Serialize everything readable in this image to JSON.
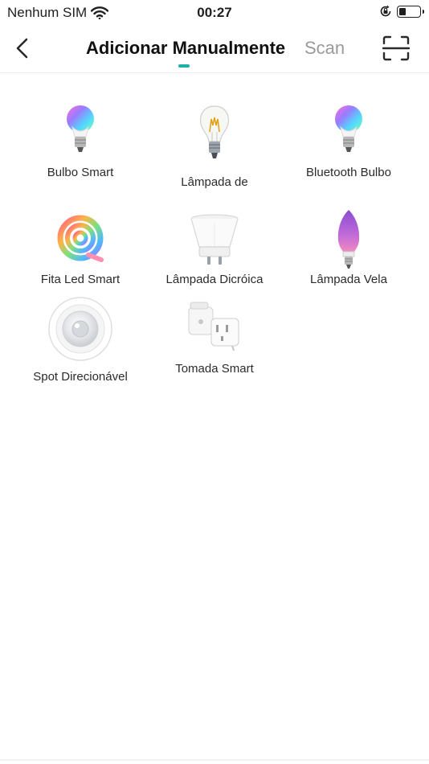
{
  "status_bar": {
    "carrier": "Nenhum SIM",
    "time": "00:27",
    "battery_level": 0.35
  },
  "header": {
    "tab_manual": "Adicionar Manualmente",
    "tab_scan": "Scan",
    "icons": [
      "chevron-left-icon",
      "scan-frame-icon"
    ],
    "accent": "#1fb2a6"
  },
  "devices": [
    {
      "label": "Bulbo Smart",
      "icon": "rgb-bulb-icon"
    },
    {
      "label": "Lâmpada de",
      "icon": "filament-bulb-icon"
    },
    {
      "label": "Bluetooth Bulbo",
      "icon": "rgb-bulb-icon"
    },
    {
      "label": "Fita Led Smart",
      "icon": "led-strip-icon"
    },
    {
      "label": "Lâmpada Dicróica",
      "icon": "dichroic-lamp-icon"
    },
    {
      "label": "Lâmpada Vela",
      "icon": "candle-bulb-icon"
    },
    {
      "label": "Spot Direcionável",
      "icon": "spot-light-icon"
    },
    {
      "label": "Tomada Smart",
      "icon": "smart-plug-icon"
    }
  ]
}
